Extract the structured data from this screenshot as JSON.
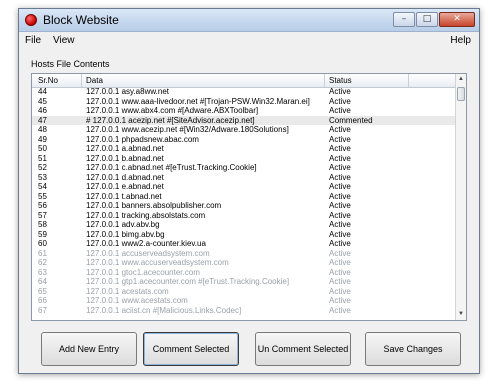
{
  "window": {
    "title": "Block Website",
    "controls": {
      "minimize": "–",
      "maximize": "□",
      "close": "✕"
    }
  },
  "menu": {
    "file": "File",
    "view": "View",
    "help": "Help"
  },
  "group_label": "Hosts File Contents",
  "columns": {
    "sr_no": "Sr.No",
    "data": "Data",
    "status": "Status"
  },
  "rows": [
    {
      "sr": "44",
      "data": "127.0.0.1  asy.a8ww.net",
      "status": "Active"
    },
    {
      "sr": "45",
      "data": "127.0.0.1  www.aaa-livedoor.net #[Trojan-PSW.Win32.Maran.ei]",
      "status": "Active"
    },
    {
      "sr": "46",
      "data": "127.0.0.1  www.abx4.com #[Adware.ABXToolbar]",
      "status": "Active"
    },
    {
      "sr": "47",
      "data": "# 127.0.0.1  acezip.net #[SiteAdvisor.acezip.net]",
      "status": "Commented"
    },
    {
      "sr": "48",
      "data": "127.0.0.1  www.acezip.net #[Win32/Adware.180Solutions]",
      "status": "Active"
    },
    {
      "sr": "49",
      "data": "127.0.0.1  phpadsnew.abac.com",
      "status": "Active"
    },
    {
      "sr": "50",
      "data": "127.0.0.1  a.abnad.net",
      "status": "Active"
    },
    {
      "sr": "51",
      "data": "127.0.0.1  b.abnad.net",
      "status": "Active"
    },
    {
      "sr": "52",
      "data": "127.0.0.1  c.abnad.net #[eTrust.Tracking.Cookie]",
      "status": "Active"
    },
    {
      "sr": "53",
      "data": "127.0.0.1  d.abnad.net",
      "status": "Active"
    },
    {
      "sr": "54",
      "data": "127.0.0.1  e.abnad.net",
      "status": "Active"
    },
    {
      "sr": "55",
      "data": "127.0.0.1  t.abnad.net",
      "status": "Active"
    },
    {
      "sr": "56",
      "data": "127.0.0.1  banners.absolpublisher.com",
      "status": "Active"
    },
    {
      "sr": "57",
      "data": "127.0.0.1  tracking.absolstats.com",
      "status": "Active"
    },
    {
      "sr": "58",
      "data": "127.0.0.1  adv.abv.bg",
      "status": "Active"
    },
    {
      "sr": "59",
      "data": "127.0.0.1  bimg.abv.bg",
      "status": "Active"
    },
    {
      "sr": "60",
      "data": "127.0.0.1  www2.a-counter.kiev.ua",
      "status": "Active"
    },
    {
      "sr": "61",
      "data": "127.0.0.1  accuserveadsystem.com",
      "status": "Active"
    },
    {
      "sr": "62",
      "data": "127.0.0.1  www.accuserveadsystem.com",
      "status": "Active"
    },
    {
      "sr": "63",
      "data": "127.0.0.1  gtoc1.acecounter.com",
      "status": "Active"
    },
    {
      "sr": "64",
      "data": "127.0.0.1  gtp1.acecounter.com #[eTrust.Tracking.Cookie]",
      "status": "Active"
    },
    {
      "sr": "65",
      "data": "127.0.0.1  acestats.com",
      "status": "Active"
    },
    {
      "sr": "66",
      "data": "127.0.0.1  www.acestats.com",
      "status": "Active"
    },
    {
      "sr": "67",
      "data": "127.0.0.1  aciist.cn #[Malicious.Links.Codec]",
      "status": "Active"
    }
  ],
  "buttons": {
    "add": "Add New Entry",
    "comment": "Comment Selected",
    "uncomment": "Un Comment Selected",
    "save": "Save Changes"
  },
  "scrollbar": {
    "up": "▲",
    "down": "▼"
  }
}
